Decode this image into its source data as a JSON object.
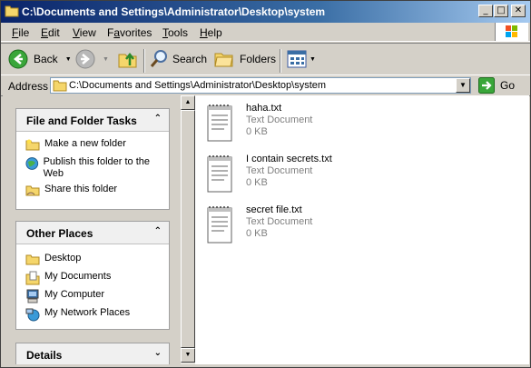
{
  "window": {
    "title": "C:\\Documents and Settings\\Administrator\\Desktop\\system",
    "controls": {
      "minimize": "_",
      "maximize": "□",
      "close": "✕"
    }
  },
  "menu": [
    {
      "label": "File",
      "accel": "F",
      "rest": "ile"
    },
    {
      "label": "Edit",
      "accel": "E",
      "rest": "dit"
    },
    {
      "label": "View",
      "accel": "V",
      "rest": "iew"
    },
    {
      "label": "Favorites",
      "accel": "a",
      "pre": "F",
      "rest": "vorites"
    },
    {
      "label": "Tools",
      "accel": "T",
      "rest": "ools"
    },
    {
      "label": "Help",
      "accel": "H",
      "rest": "elp"
    }
  ],
  "toolbar": {
    "back": "Back",
    "search": "Search",
    "folders": "Folders"
  },
  "address": {
    "label": "Address",
    "value": "C:\\Documents and Settings\\Administrator\\Desktop\\system",
    "go": "Go"
  },
  "tasks_panel": {
    "title": "File and Folder Tasks",
    "items": [
      {
        "label": "Make a new folder"
      },
      {
        "label": "Publish this folder to the Web"
      },
      {
        "label": "Share this folder"
      }
    ]
  },
  "places_panel": {
    "title": "Other Places",
    "items": [
      {
        "label": "Desktop"
      },
      {
        "label": "My Documents"
      },
      {
        "label": "My Computer"
      },
      {
        "label": "My Network Places"
      }
    ]
  },
  "details_panel": {
    "title": "Details"
  },
  "files": [
    {
      "name": "haha.txt",
      "type": "Text Document",
      "size": "0 KB"
    },
    {
      "name": "I contain secrets.txt",
      "type": "Text Document",
      "size": "0 KB"
    },
    {
      "name": "secret file.txt",
      "type": "Text Document",
      "size": "0 KB"
    }
  ],
  "colors": {
    "title_start": "#0a246a",
    "title_end": "#a6caf0",
    "face": "#d4d0c8"
  }
}
